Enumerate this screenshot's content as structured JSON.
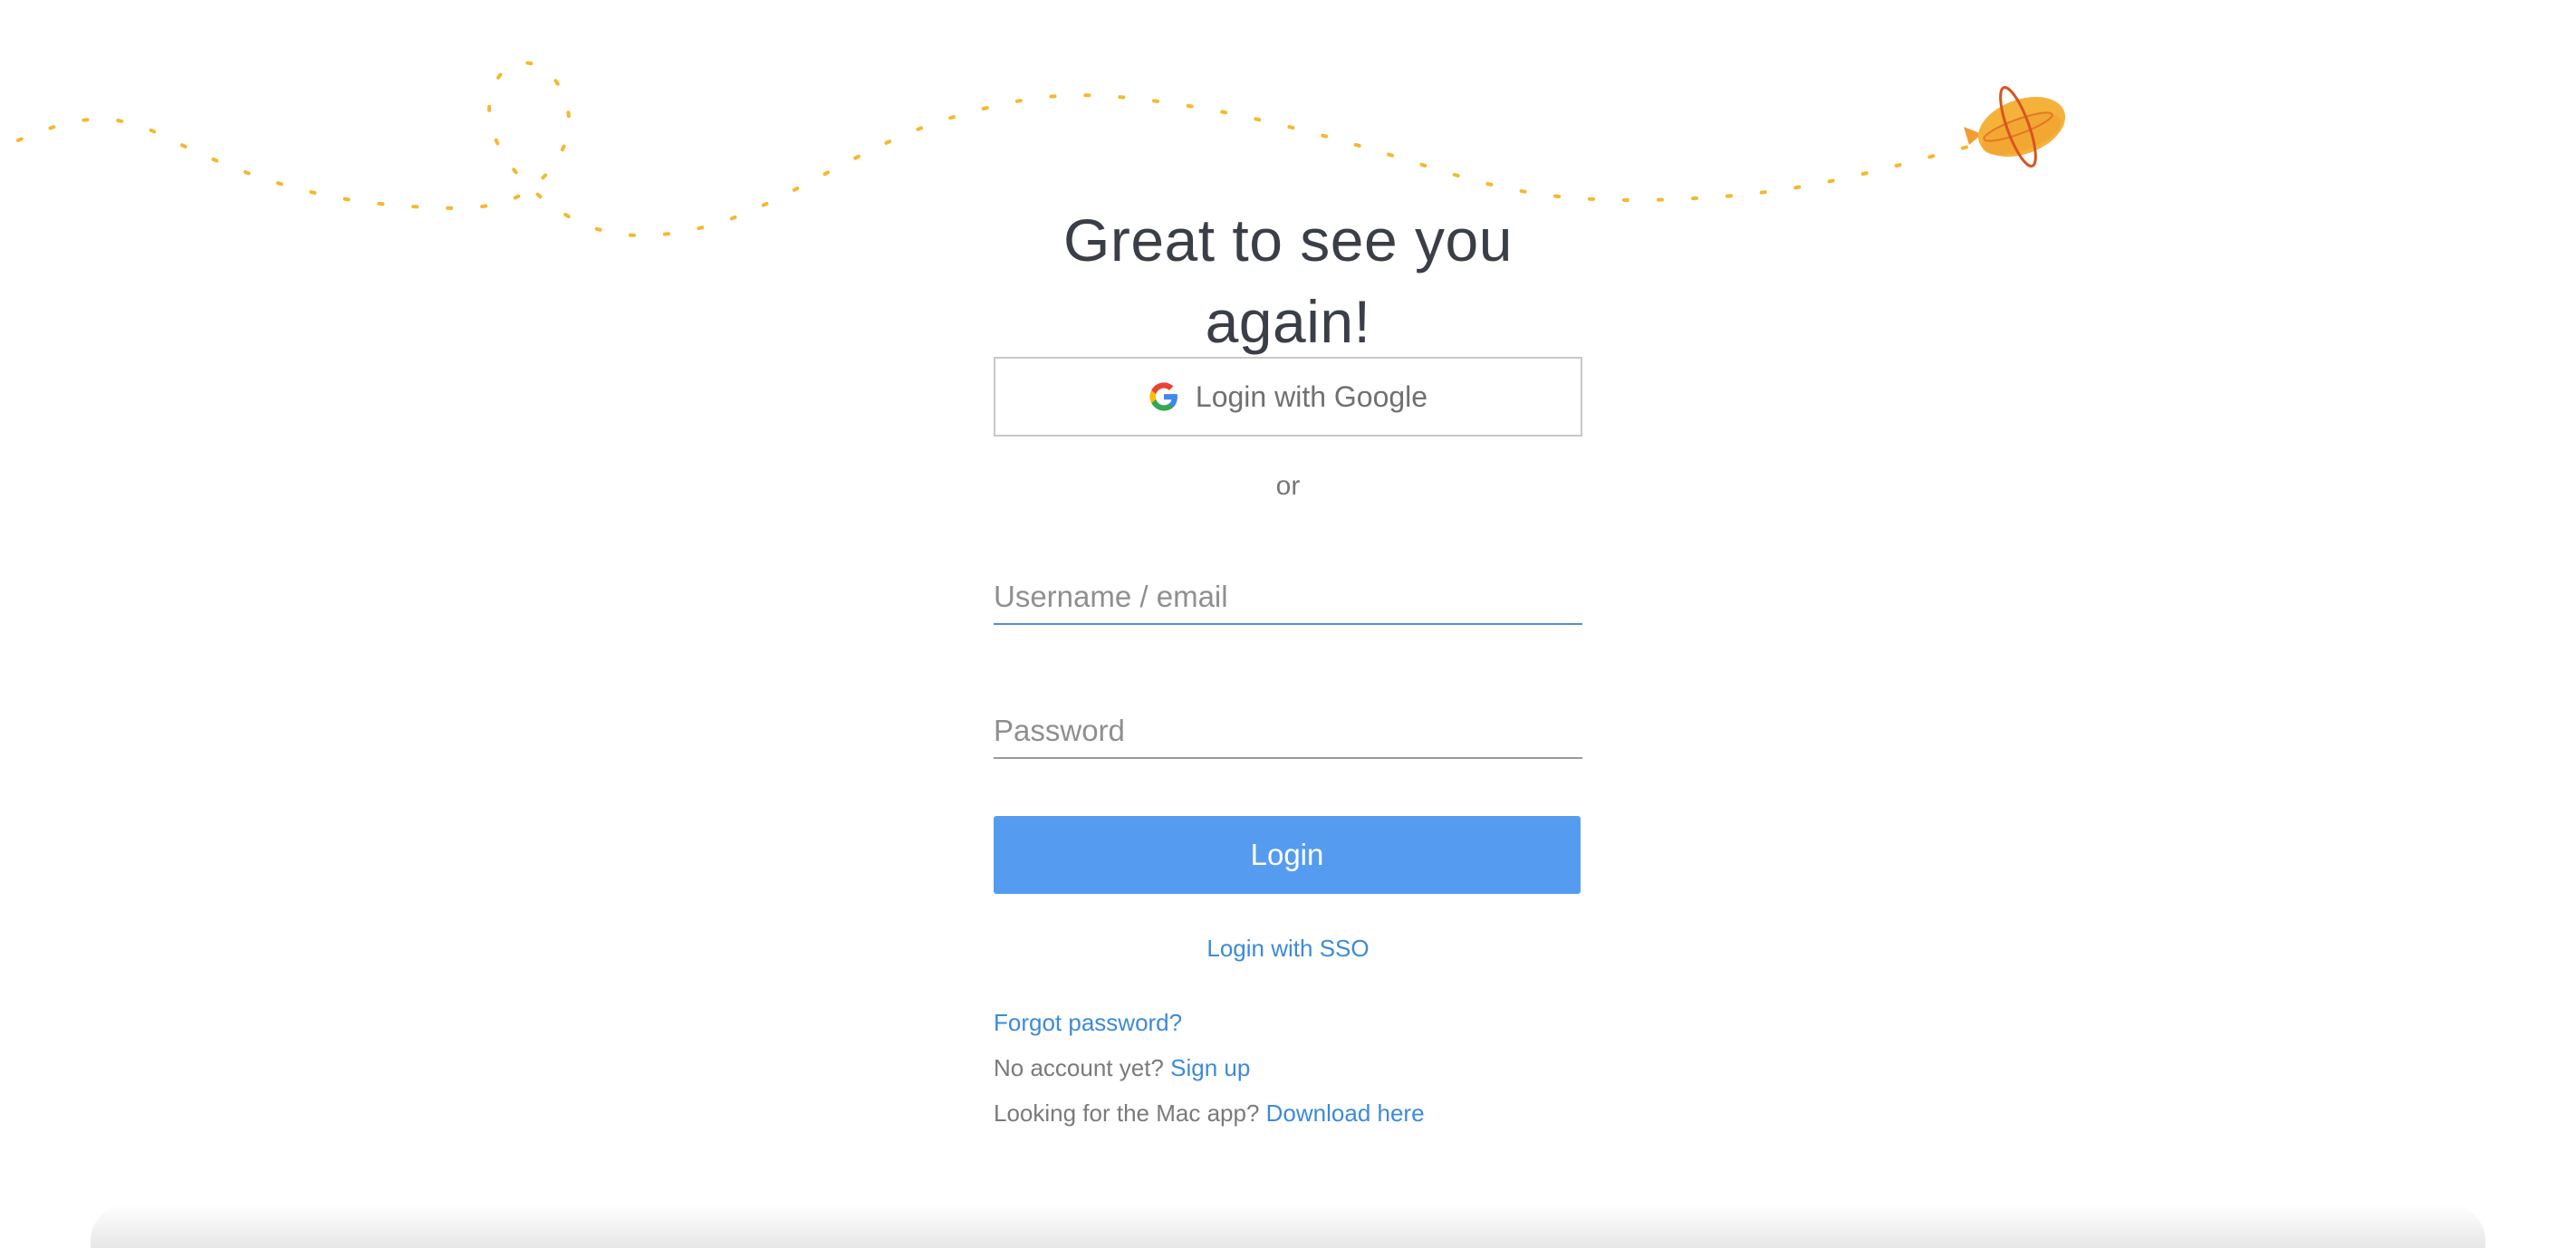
{
  "heading": "Great to see you again!",
  "google_button": {
    "label": "Login with Google",
    "icon": "google-icon"
  },
  "divider": "or",
  "username": {
    "placeholder": "Username / email",
    "value": ""
  },
  "password": {
    "placeholder": "Password",
    "value": ""
  },
  "login_button": "Login",
  "sso_link": "Login with SSO",
  "forgot_password": "Forgot password?",
  "signup": {
    "prompt": "No account yet?",
    "link": "Sign up"
  },
  "mac_app": {
    "prompt": "Looking for the Mac app?",
    "link": "Download here"
  },
  "colors": {
    "primary": "#559cf0",
    "link": "#3d8ad9",
    "path_dots": "#f5b82e",
    "blimp": "#f3a53a"
  }
}
